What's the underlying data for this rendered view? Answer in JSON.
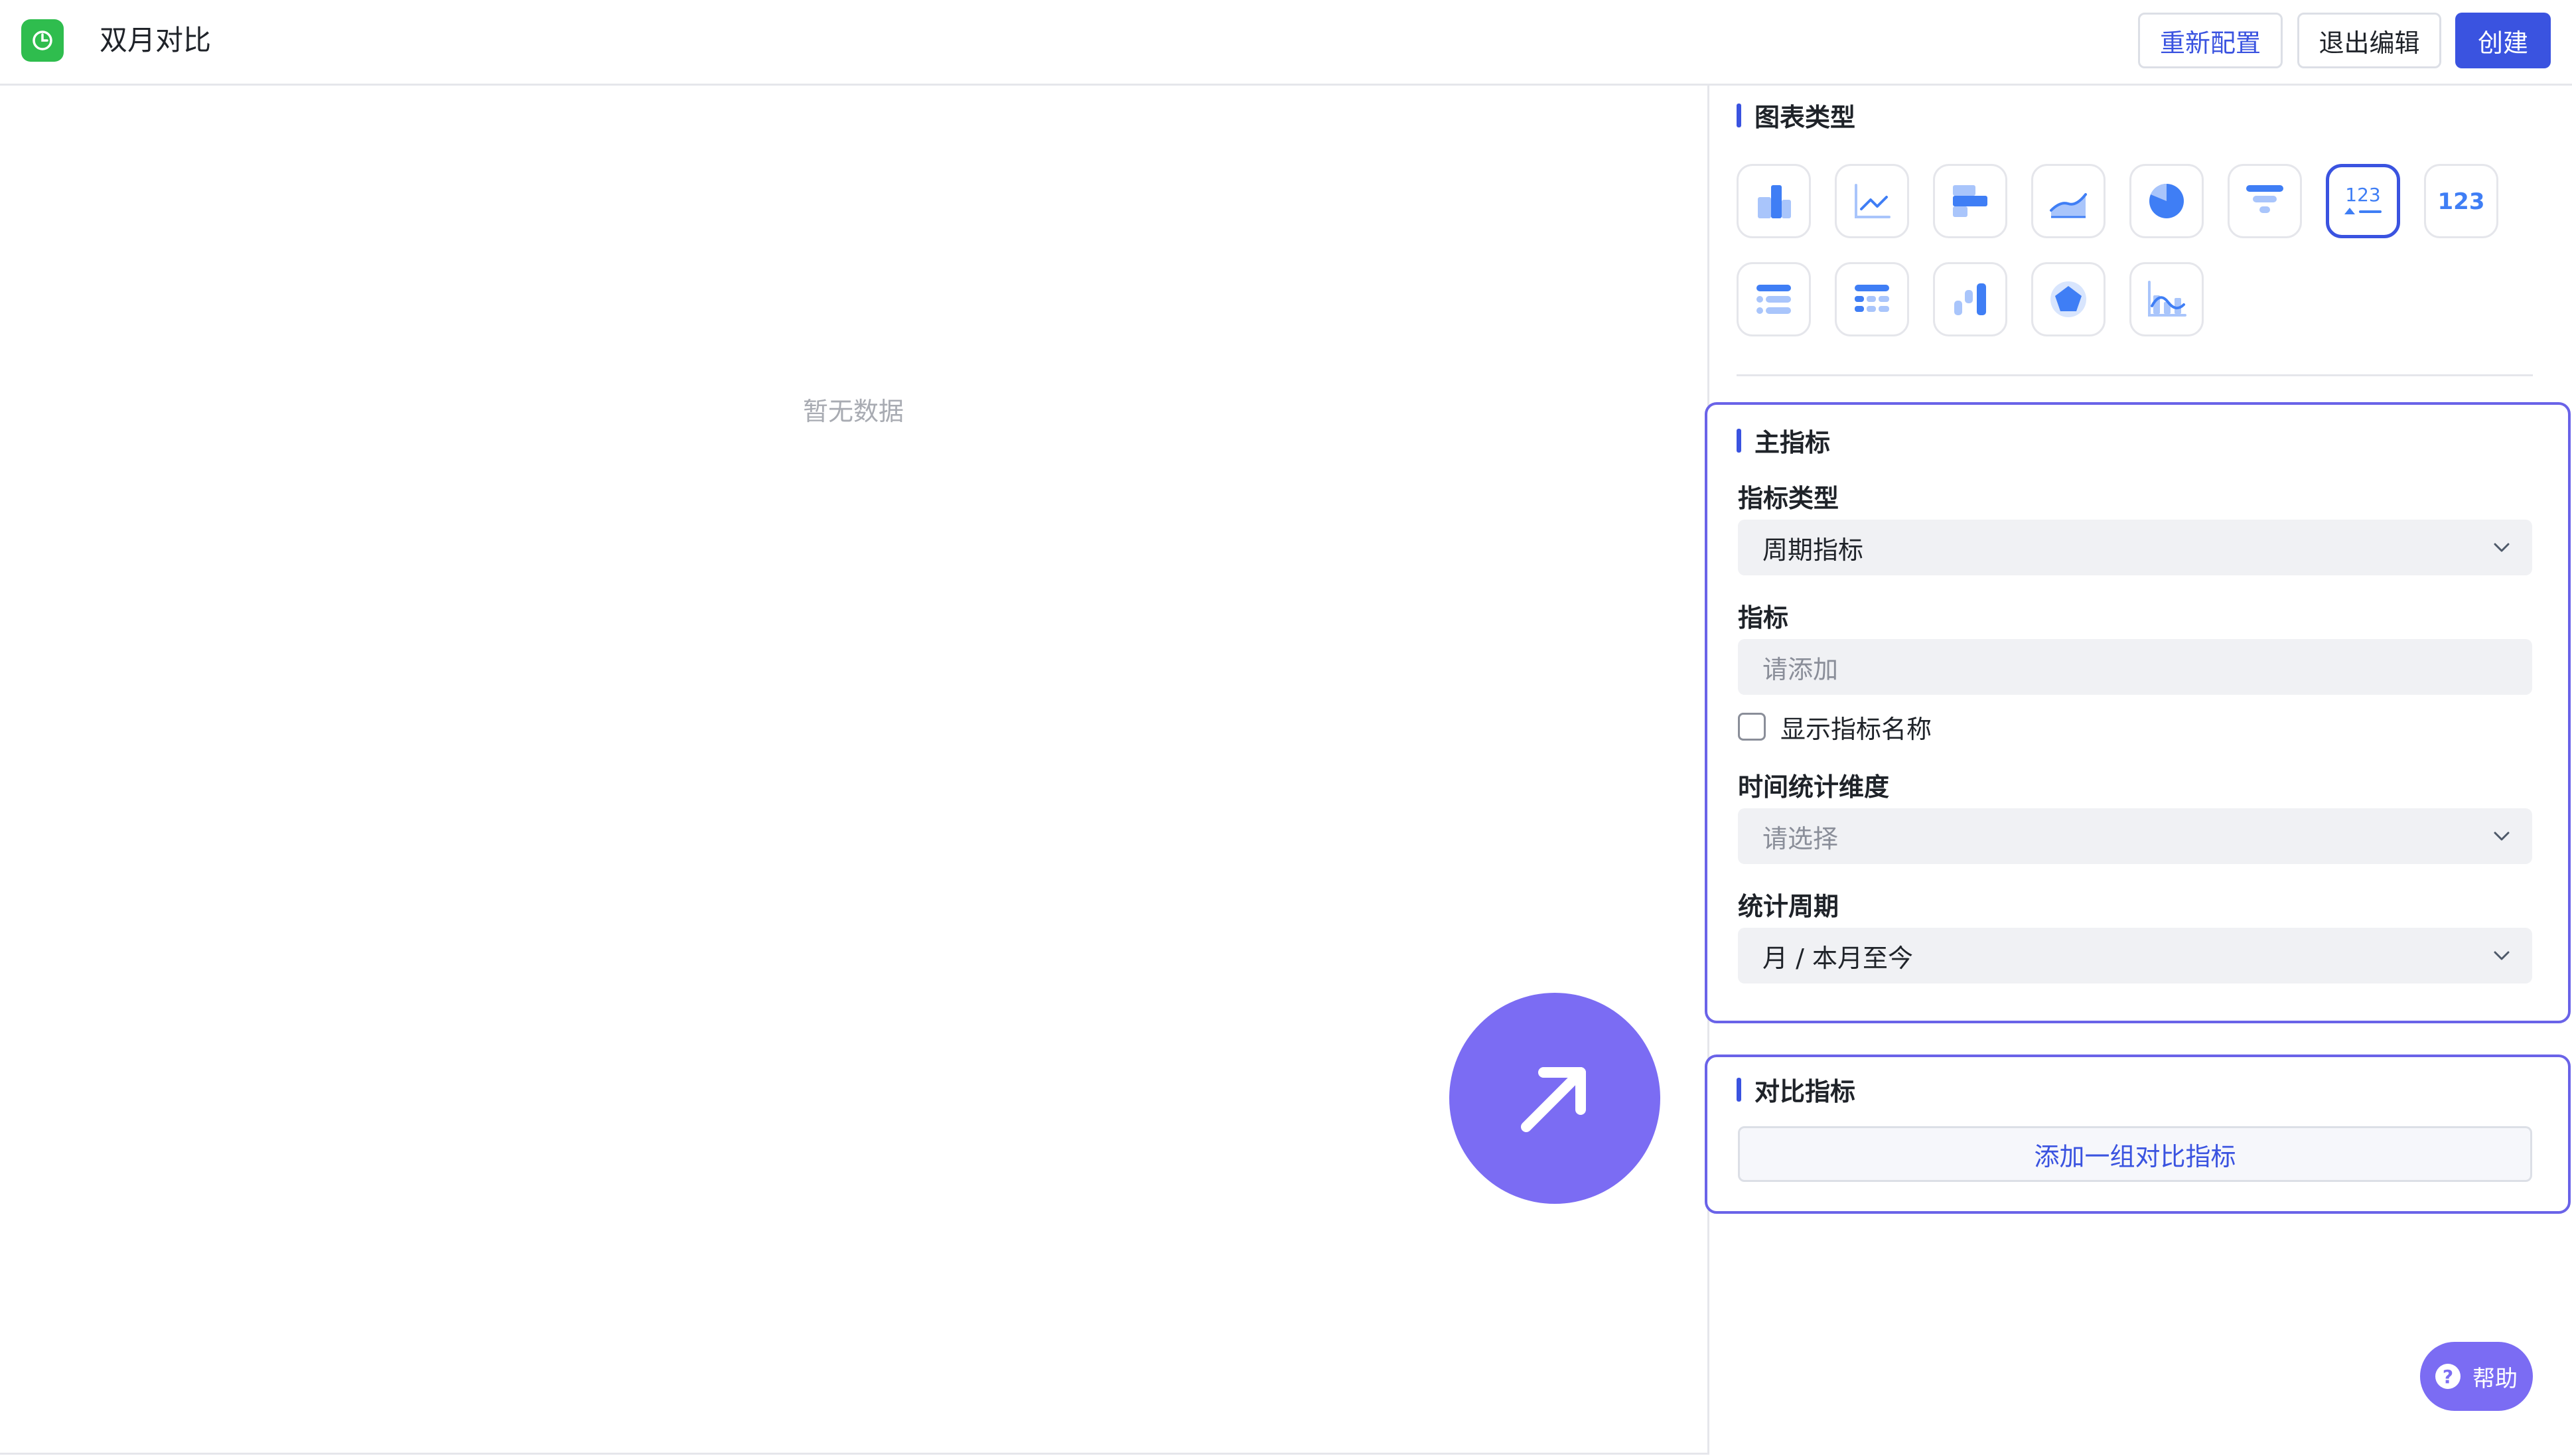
{
  "header": {
    "title": "双月对比",
    "reset_label": "重新配置",
    "exit_label": "退出编辑",
    "create_label": "创建"
  },
  "canvas": {
    "empty_text": "暂无数据"
  },
  "chart_types": {
    "title": "图表类型",
    "selected_index": 6,
    "icons": [
      "column-chart-icon",
      "line-chart-icon",
      "bar-chart-icon",
      "area-chart-icon",
      "pie-chart-icon",
      "funnel-chart-icon",
      "metric-card-compare-icon",
      "metric-card-icon",
      "list-icon",
      "detail-table-icon",
      "bar-compare-icon",
      "radar-chart-icon",
      "dual-axis-chart-icon"
    ],
    "number_glyph": "123"
  },
  "main_metric": {
    "title": "主指标",
    "metric_type_label": "指标类型",
    "metric_type_value": "周期指标",
    "metric_label": "指标",
    "metric_placeholder": "请添加",
    "show_name_label": "显示指标名称",
    "show_name_checked": false,
    "time_dim_label": "时间统计维度",
    "time_dim_placeholder": "请选择",
    "period_label": "统计周期",
    "period_value": "月 / 本月至今"
  },
  "compare_metric": {
    "title": "对比指标",
    "add_label": "添加一组对比指标"
  },
  "help": {
    "label": "帮助",
    "icon_glyph": "?"
  },
  "colors": {
    "accent": "#3a53e0",
    "panel_border": "#6a63e8",
    "fab": "#7b6cf3",
    "logo": "#2fbd4e",
    "icon_primary": "#3f7ef5",
    "icon_light": "#a9c5fb"
  }
}
